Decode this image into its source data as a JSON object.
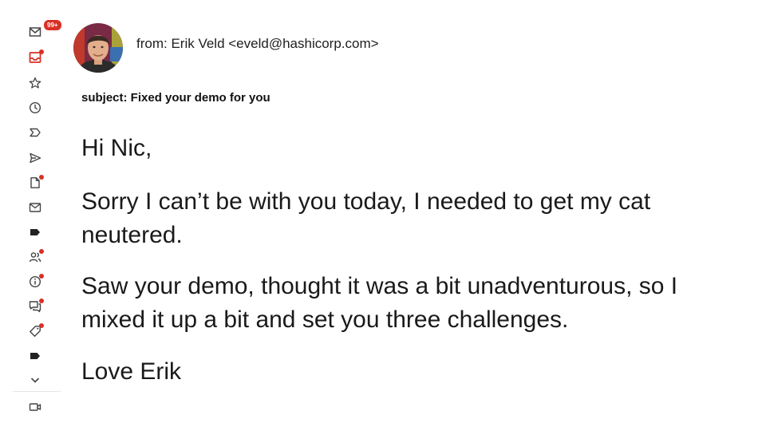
{
  "rail": {
    "mail_badge": "99+",
    "items": [
      {
        "icon": "mail-icon",
        "label": "Mail",
        "dot": false
      },
      {
        "icon": "inbox-icon",
        "label": "Inbox",
        "dot": true,
        "active": true,
        "color": "#d93025"
      },
      {
        "icon": "star-icon",
        "label": "Starred",
        "dot": false
      },
      {
        "icon": "clock-icon",
        "label": "Snoozed",
        "dot": false
      },
      {
        "icon": "important-icon",
        "label": "Important",
        "dot": false
      },
      {
        "icon": "send-icon",
        "label": "Sent",
        "dot": false
      },
      {
        "icon": "draft-icon",
        "label": "Drafts",
        "dot": true
      },
      {
        "icon": "envelope-icon",
        "label": "All mail",
        "dot": false
      },
      {
        "icon": "label-icon",
        "label": "Label",
        "dot": false
      },
      {
        "icon": "people-icon",
        "label": "Social",
        "dot": true
      },
      {
        "icon": "info-icon",
        "label": "Updates",
        "dot": true
      },
      {
        "icon": "forum-icon",
        "label": "Forums",
        "dot": true
      },
      {
        "icon": "tag-icon",
        "label": "Promotions",
        "dot": true
      },
      {
        "icon": "label-icon",
        "label": "Label",
        "dot": false
      },
      {
        "icon": "chevron-down-icon",
        "label": "More",
        "dot": false
      },
      {
        "icon": "video-icon",
        "label": "Meet",
        "dot": false
      }
    ],
    "accent_color": "#d93025"
  },
  "email": {
    "from": "from: Erik Veld <eveld@hashicorp.com>",
    "subject": "subject: Fixed your demo for you",
    "greeting": "Hi Nic,",
    "paragraph1": "Sorry I can’t be with you today, I needed to get my cat neutered.",
    "paragraph2": "Saw your demo, thought it was a bit unadventurous, so I mixed it up a bit and set you three challenges.",
    "signoff": "Love Erik"
  }
}
